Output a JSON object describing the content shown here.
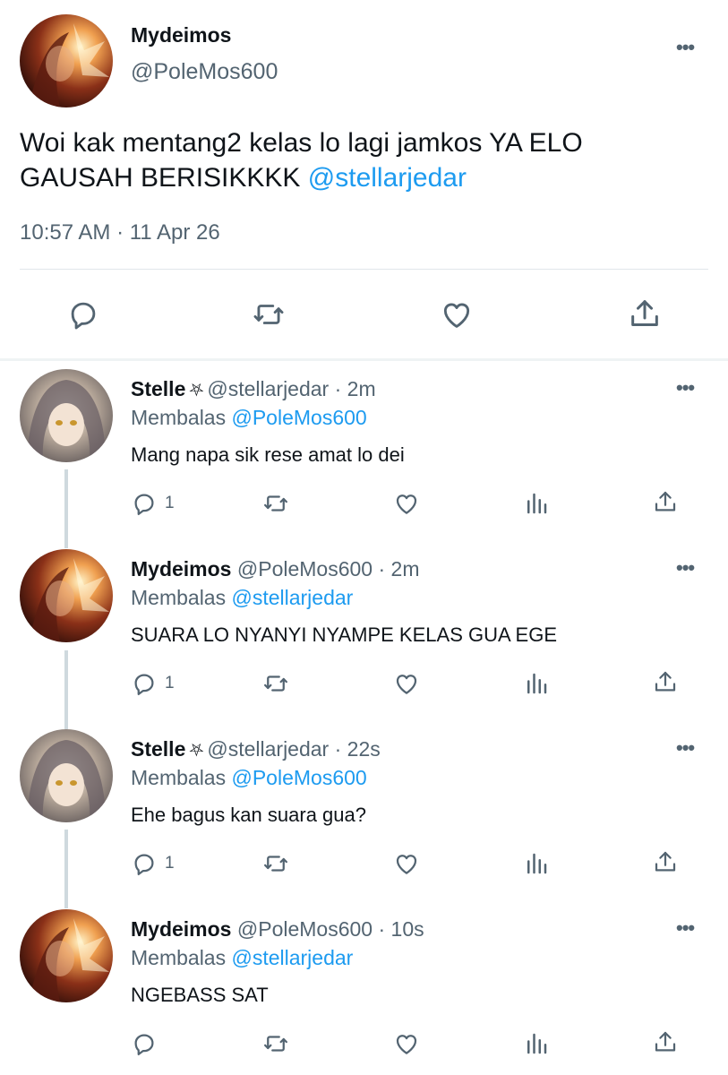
{
  "tweet": {
    "author_name": "Mydeimos",
    "author_handle": "@PoleMos600",
    "text": "Woi kak mentang2 kelas lo lagi jamkos YA ELO GAUSAH BERISIKKKK ",
    "mention": "@stellarjedar",
    "timestamp": "10:57 AM · 11 Apr 26",
    "more_label": "•••"
  },
  "replies": [
    {
      "name": "Stelle",
      "badge": "⛧",
      "handle": "@stellarjedar",
      "time": "· 2m",
      "replying_prefix": "Membalas ",
      "replying_to": "@PoleMos600",
      "text": "Mang napa sik rese amat lo dei",
      "reply_count": "1",
      "avatar": "stelle"
    },
    {
      "name": "Mydeimos",
      "badge": "",
      "handle": "@PoleMos600",
      "time": "· 2m",
      "replying_prefix": "Membalas ",
      "replying_to": "@stellarjedar",
      "text": "SUARA LO NYANYI NYAMPE KELAS GUA EGE",
      "reply_count": "1",
      "avatar": "mydeimos"
    },
    {
      "name": "Stelle",
      "badge": "⛧",
      "handle": "@stellarjedar",
      "time": "· 22s",
      "replying_prefix": "Membalas ",
      "replying_to": "@PoleMos600",
      "text": "Ehe bagus kan suara gua?",
      "reply_count": "1",
      "avatar": "stelle"
    },
    {
      "name": "Mydeimos",
      "badge": "",
      "handle": "@PoleMos600",
      "time": "· 10s",
      "replying_prefix": "Membalas ",
      "replying_to": "@stellarjedar",
      "text": "NGEBASS SAT",
      "reply_count": "",
      "avatar": "mydeimos"
    }
  ],
  "icons": {
    "reply": "reply-icon",
    "retweet": "retweet-icon",
    "like": "like-icon",
    "views": "views-icon",
    "share": "share-icon",
    "more": "more-icon"
  },
  "colors": {
    "link": "#1d9bf0",
    "secondary_text": "#536471",
    "thread_line": "#cfd9de"
  }
}
